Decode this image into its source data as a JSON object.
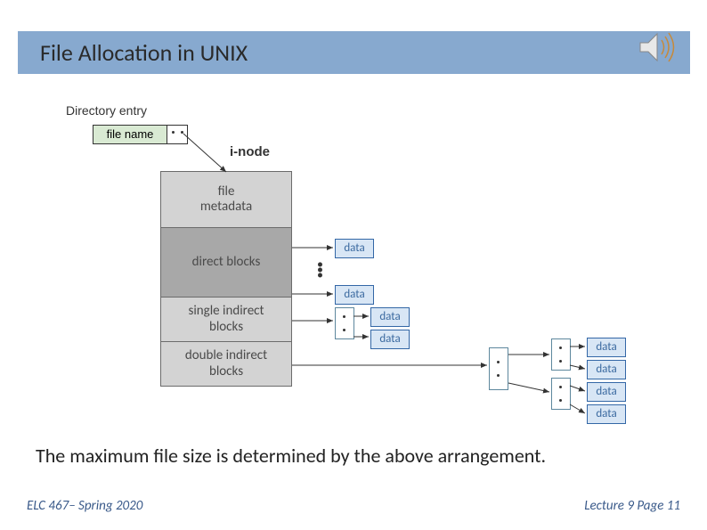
{
  "title": "File Allocation in UNIX",
  "labels": {
    "directory_entry": "Directory entry",
    "file_name": "file name",
    "inode": "i-node",
    "data": "data"
  },
  "inode_sections": {
    "metadata_l1": "file",
    "metadata_l2": "metadata",
    "direct": "direct blocks",
    "single_l1": "single indirect",
    "single_l2": "blocks",
    "double_l1": "double indirect",
    "double_l2": "blocks"
  },
  "body_text": "The maximum file size is determined by the above arrangement.",
  "footer": {
    "left": "ELC 467– Spring 2020",
    "right": "Lecture 9 Page 11"
  }
}
